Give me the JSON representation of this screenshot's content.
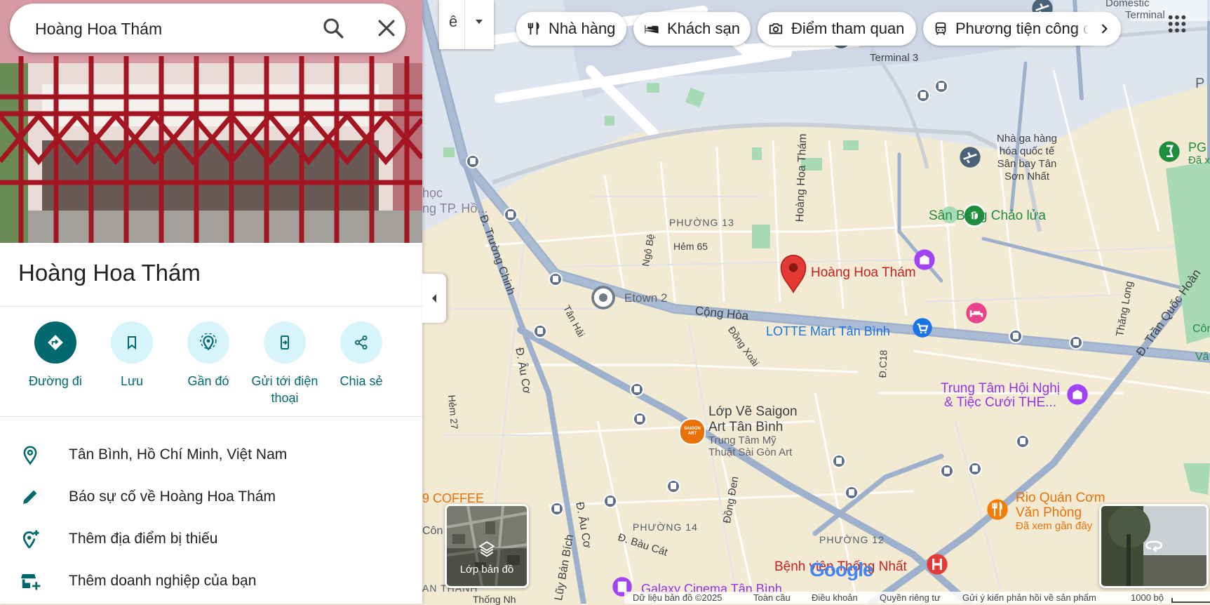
{
  "search": {
    "value": "Hoàng Hoa Thám"
  },
  "place": {
    "title": "Hoàng Hoa Thám"
  },
  "actions": [
    {
      "label": "Đường đi"
    },
    {
      "label": "Lưu"
    },
    {
      "label": "Gần đó"
    },
    {
      "label": "Gửi tới điện",
      "label2": "thoại"
    },
    {
      "label": "Chia sẻ"
    }
  ],
  "info": [
    {
      "text": "Tân Bình, Hồ Chí Minh, Việt Nam"
    },
    {
      "text": "Báo sự cố về Hoàng Hoa Thám"
    },
    {
      "text": "Thêm địa điểm bị thiếu"
    },
    {
      "text": "Thêm doanh nghiệp của bạn"
    }
  ],
  "toolbar": {
    "ime_label": "ê"
  },
  "chips": [
    {
      "label": "Nhà hàng"
    },
    {
      "label": "Khách sạn"
    },
    {
      "label": "Điểm tham quan"
    },
    {
      "label": "Phương tiện công cộng"
    }
  ],
  "map": {
    "labels": {
      "domestic1": "Domestic",
      "domestic2": "Terminal",
      "terminal3": "Terminal 3",
      "cargo1": "Nhà ga hàng",
      "cargo2": "hóa quốc tế",
      "cargo3": "Sân bay Tân",
      "cargo4": "Sơn Nhất",
      "pg1": "PG",
      "pg2": "Đã x",
      "p_edge": "P",
      "hoc1": "học",
      "hoc2": "ng TP. Hồ...",
      "san_bong": "Sân Bóng Chảo lửa",
      "phuong13": "PHƯỜNG 13",
      "hem65": "Hẻm 65",
      "ngo_be": "Ngô Bệ",
      "hht_road": "Hoàng Hoa Thám",
      "pin_label": "Hoàng Hoa Thám",
      "etown": "Etown 2",
      "cong_hoa": "Cộng Hòa",
      "lotte": "LOTTE Mart Tân Bình",
      "truong_chinh": "Đ. Trường Chinh",
      "tan_hai": "Tân Hải",
      "dong_xoai": "Đồng Xoài",
      "c18": "Đ.C18",
      "thang_long": "Thăng Long",
      "tran_quoc_hoan": "Đ. Trần Quốc Hoàn",
      "con": "Côn",
      "va": "Vă",
      "au_co1": "Đ. Âu Cơ",
      "hem27": "Hẻm 27",
      "trung_tam1": "Trung Tâm Hội Nghị",
      "trung_tam2": "& Tiệc Cưới THE...",
      "lop_ve1": "Lớp Vẽ Saigon",
      "lop_ve2": "Art Tân Bình",
      "my_thuat1": "Trung Tâm Mỹ",
      "my_thuat2": "Thuật Sài Gòn Art",
      "coffee": "9 COFFEE",
      "con_left": "Côn",
      "au_co2": "Đ. Âu Cơ",
      "van_bich": "Lũy Bán Bích",
      "dong_den": "Đồng Đen",
      "phuong14": "PHƯỜNG 14",
      "bau_cat": "Đ. Bàu Cát",
      "phuong12": "PHƯỜNG 12",
      "rio1": "Rio Quán Cơm",
      "rio2": "Văn Phòng",
      "rio3": "Đã xem gần đây",
      "benh_vien": "Bệnh viện Thống Nhất",
      "galaxy": "Galaxy Cinema Tân Bình",
      "an_thanh": "AN THANH",
      "thong_nh": "Thống Nh"
    },
    "layers_label": "Lớp bản đồ",
    "saigon_art_badge": "SAIGON ART",
    "google_logo": "Google"
  },
  "footer": {
    "data": "Dữ liệu bản đồ ©2025",
    "global": "Toàn cầu",
    "terms": "Điều khoản",
    "privacy": "Quyền riêng tư",
    "feedback": "Gửi ý kiến phản hồi về sản phẩm",
    "scale": "1000 bộ"
  },
  "colors": {
    "accent": "#00696f",
    "action_bg": "#d6f4f9",
    "pin": "#e53935",
    "road": "#9eb1cc",
    "land": "#f3ead3"
  }
}
